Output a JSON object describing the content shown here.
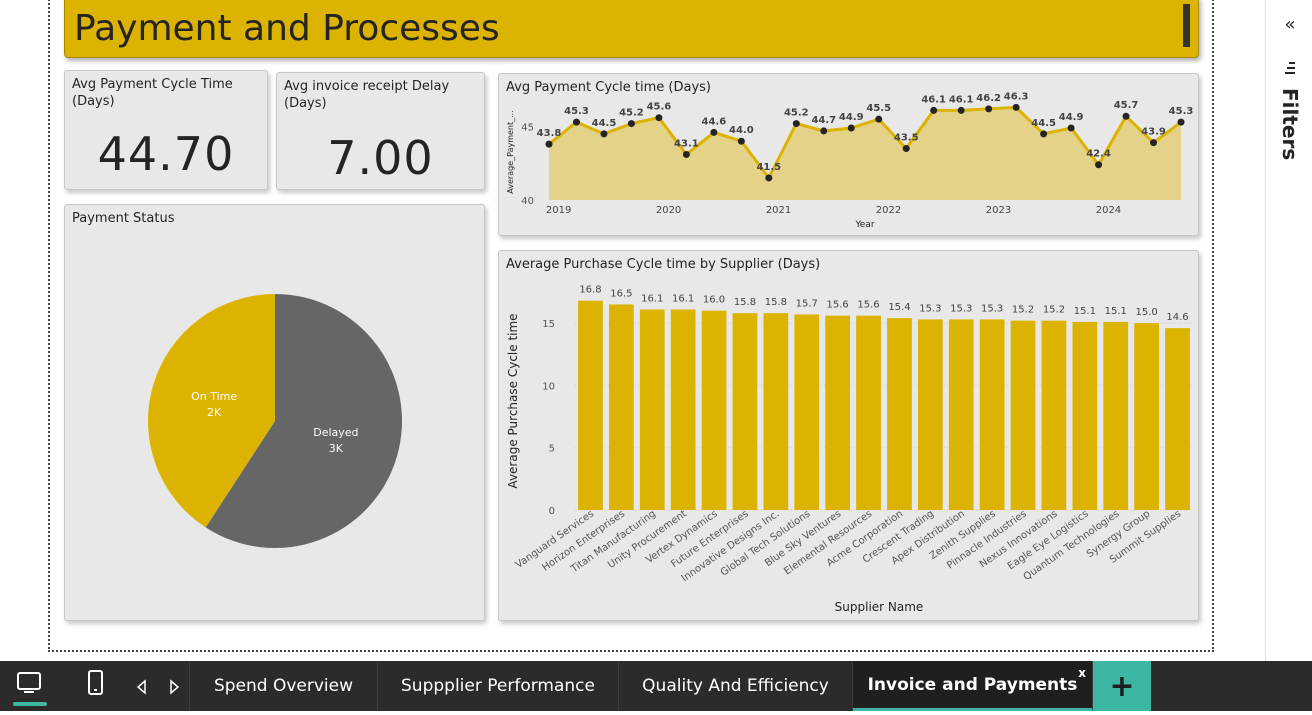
{
  "title": "Payment and Processes",
  "kpis": {
    "payment_cycle": {
      "title": "Avg Payment Cycle Time (Days)",
      "value": "44.70"
    },
    "receipt_delay": {
      "title": "Avg invoice receipt Delay (Days)",
      "value": "7.00"
    }
  },
  "filters": {
    "label": "Filters",
    "collapse_icon": "chevron-double-left",
    "icon": "filter-icon"
  },
  "bottom_bar": {
    "desktop_icon": "desktop-icon",
    "mobile_icon": "mobile-icon",
    "prev_icon": "triangle-left",
    "next_icon": "triangle-right",
    "tabs": [
      {
        "label": "Spend Overview",
        "active": false
      },
      {
        "label": "Suppplier Performance",
        "active": false
      },
      {
        "label": "Quality And Efficiency",
        "active": false
      },
      {
        "label": "Invoice and Payments",
        "active": true
      }
    ],
    "close_label": "x",
    "add_label": "+"
  },
  "colors": {
    "gold": "#dbb300",
    "grey": "#666666",
    "card_bg": "#e8e8e8",
    "teal": "#3bb7a4"
  },
  "chart_data": [
    {
      "id": "pie",
      "type": "pie",
      "title": "Payment Status",
      "slices": [
        {
          "name": "On Time",
          "label": "2K",
          "value": 2,
          "color": "#dbb300"
        },
        {
          "name": "Delayed",
          "label": "3K",
          "value": 2.9,
          "color": "#666666"
        }
      ]
    },
    {
      "id": "line",
      "type": "area",
      "title": "Avg Payment Cycle time (Days)",
      "xlabel": "Year",
      "ylabel": "Average_Payment_...",
      "x_ticks": [
        "2019",
        "2020",
        "2021",
        "2022",
        "2023",
        "2024"
      ],
      "y_ticks": [
        40,
        45
      ],
      "ylim": [
        40,
        46.6
      ],
      "values": [
        43.8,
        45.3,
        44.5,
        45.2,
        45.6,
        43.1,
        44.6,
        44.0,
        41.5,
        45.2,
        44.7,
        44.9,
        45.5,
        43.5,
        46.1,
        46.1,
        46.2,
        46.3,
        44.5,
        44.9,
        42.4,
        45.7,
        43.9,
        45.3
      ],
      "labels": [
        "43.8",
        "45.3",
        "44.5",
        "45.2",
        "45.6",
        "43.1",
        "44.6",
        "44.0",
        "41.5",
        "45.2",
        "44.7",
        "44.9",
        "45.5",
        "43.5",
        "46.1",
        "46.1",
        "46.2",
        "46.3",
        "44.5",
        "44.9",
        "42.4",
        "45.7",
        "43.9",
        "45.3"
      ],
      "color": "#dbb300"
    },
    {
      "id": "bar",
      "type": "bar",
      "title": "Average Purchase Cycle time by Supplier (Days)",
      "xlabel": "Supplier Name",
      "ylabel": "Average Purchase Cycle time",
      "y_ticks": [
        0,
        5,
        10,
        15
      ],
      "ylim": [
        0,
        17.5
      ],
      "categories": [
        "Vanguard Services",
        "Horizon Enterprises",
        "Titan Manufacturing",
        "Unity Procurement",
        "Vertex Dynamics",
        "Future Enterprises",
        "Innovative Designs Inc.",
        "Global Tech Solutions",
        "Blue Sky Ventures",
        "Elemental Resources",
        "Acme Corporation",
        "Crescent Trading",
        "Apex Distribution",
        "Zenith Supplies",
        "Pinnacle Industries",
        "Nexus Innovations",
        "Eagle Eye Logistics",
        "Quantum Technologies",
        "Synergy Group",
        "Summit Supplies"
      ],
      "values": [
        16.8,
        16.5,
        16.1,
        16.1,
        16.0,
        15.8,
        15.8,
        15.7,
        15.6,
        15.6,
        15.4,
        15.3,
        15.3,
        15.3,
        15.2,
        15.2,
        15.1,
        15.1,
        15.0,
        14.6
      ],
      "labels": [
        "16.8",
        "16.5",
        "16.1",
        "16.1",
        "16.0",
        "15.8",
        "15.8",
        "15.7",
        "15.6",
        "15.6",
        "15.4",
        "15.3",
        "15.3",
        "15.3",
        "15.2",
        "15.2",
        "15.1",
        "15.1",
        "15.0",
        "14.6"
      ],
      "color": "#dbb300"
    }
  ]
}
